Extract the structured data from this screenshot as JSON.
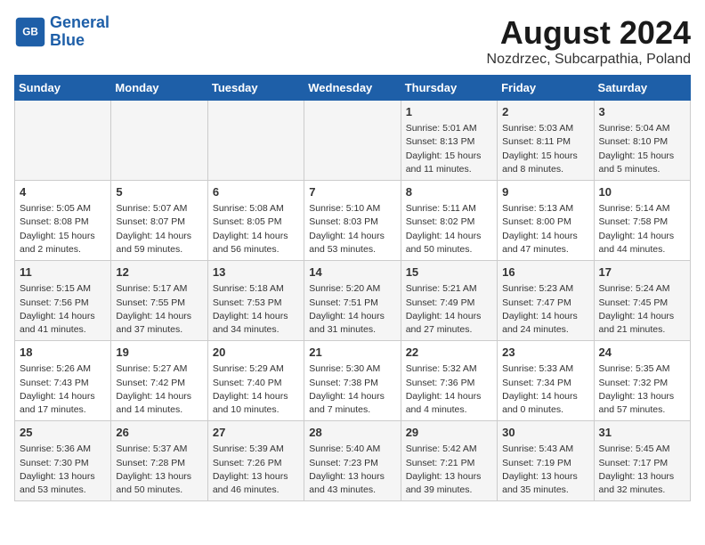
{
  "logo": {
    "line1": "General",
    "line2": "Blue"
  },
  "title": "August 2024",
  "subtitle": "Nozdrzec, Subcarpathia, Poland",
  "days_of_week": [
    "Sunday",
    "Monday",
    "Tuesday",
    "Wednesday",
    "Thursday",
    "Friday",
    "Saturday"
  ],
  "weeks": [
    [
      {
        "day": "",
        "info": ""
      },
      {
        "day": "",
        "info": ""
      },
      {
        "day": "",
        "info": ""
      },
      {
        "day": "",
        "info": ""
      },
      {
        "day": "1",
        "info": "Sunrise: 5:01 AM\nSunset: 8:13 PM\nDaylight: 15 hours\nand 11 minutes."
      },
      {
        "day": "2",
        "info": "Sunrise: 5:03 AM\nSunset: 8:11 PM\nDaylight: 15 hours\nand 8 minutes."
      },
      {
        "day": "3",
        "info": "Sunrise: 5:04 AM\nSunset: 8:10 PM\nDaylight: 15 hours\nand 5 minutes."
      }
    ],
    [
      {
        "day": "4",
        "info": "Sunrise: 5:05 AM\nSunset: 8:08 PM\nDaylight: 15 hours\nand 2 minutes."
      },
      {
        "day": "5",
        "info": "Sunrise: 5:07 AM\nSunset: 8:07 PM\nDaylight: 14 hours\nand 59 minutes."
      },
      {
        "day": "6",
        "info": "Sunrise: 5:08 AM\nSunset: 8:05 PM\nDaylight: 14 hours\nand 56 minutes."
      },
      {
        "day": "7",
        "info": "Sunrise: 5:10 AM\nSunset: 8:03 PM\nDaylight: 14 hours\nand 53 minutes."
      },
      {
        "day": "8",
        "info": "Sunrise: 5:11 AM\nSunset: 8:02 PM\nDaylight: 14 hours\nand 50 minutes."
      },
      {
        "day": "9",
        "info": "Sunrise: 5:13 AM\nSunset: 8:00 PM\nDaylight: 14 hours\nand 47 minutes."
      },
      {
        "day": "10",
        "info": "Sunrise: 5:14 AM\nSunset: 7:58 PM\nDaylight: 14 hours\nand 44 minutes."
      }
    ],
    [
      {
        "day": "11",
        "info": "Sunrise: 5:15 AM\nSunset: 7:56 PM\nDaylight: 14 hours\nand 41 minutes."
      },
      {
        "day": "12",
        "info": "Sunrise: 5:17 AM\nSunset: 7:55 PM\nDaylight: 14 hours\nand 37 minutes."
      },
      {
        "day": "13",
        "info": "Sunrise: 5:18 AM\nSunset: 7:53 PM\nDaylight: 14 hours\nand 34 minutes."
      },
      {
        "day": "14",
        "info": "Sunrise: 5:20 AM\nSunset: 7:51 PM\nDaylight: 14 hours\nand 31 minutes."
      },
      {
        "day": "15",
        "info": "Sunrise: 5:21 AM\nSunset: 7:49 PM\nDaylight: 14 hours\nand 27 minutes."
      },
      {
        "day": "16",
        "info": "Sunrise: 5:23 AM\nSunset: 7:47 PM\nDaylight: 14 hours\nand 24 minutes."
      },
      {
        "day": "17",
        "info": "Sunrise: 5:24 AM\nSunset: 7:45 PM\nDaylight: 14 hours\nand 21 minutes."
      }
    ],
    [
      {
        "day": "18",
        "info": "Sunrise: 5:26 AM\nSunset: 7:43 PM\nDaylight: 14 hours\nand 17 minutes."
      },
      {
        "day": "19",
        "info": "Sunrise: 5:27 AM\nSunset: 7:42 PM\nDaylight: 14 hours\nand 14 minutes."
      },
      {
        "day": "20",
        "info": "Sunrise: 5:29 AM\nSunset: 7:40 PM\nDaylight: 14 hours\nand 10 minutes."
      },
      {
        "day": "21",
        "info": "Sunrise: 5:30 AM\nSunset: 7:38 PM\nDaylight: 14 hours\nand 7 minutes."
      },
      {
        "day": "22",
        "info": "Sunrise: 5:32 AM\nSunset: 7:36 PM\nDaylight: 14 hours\nand 4 minutes."
      },
      {
        "day": "23",
        "info": "Sunrise: 5:33 AM\nSunset: 7:34 PM\nDaylight: 14 hours\nand 0 minutes."
      },
      {
        "day": "24",
        "info": "Sunrise: 5:35 AM\nSunset: 7:32 PM\nDaylight: 13 hours\nand 57 minutes."
      }
    ],
    [
      {
        "day": "25",
        "info": "Sunrise: 5:36 AM\nSunset: 7:30 PM\nDaylight: 13 hours\nand 53 minutes."
      },
      {
        "day": "26",
        "info": "Sunrise: 5:37 AM\nSunset: 7:28 PM\nDaylight: 13 hours\nand 50 minutes."
      },
      {
        "day": "27",
        "info": "Sunrise: 5:39 AM\nSunset: 7:26 PM\nDaylight: 13 hours\nand 46 minutes."
      },
      {
        "day": "28",
        "info": "Sunrise: 5:40 AM\nSunset: 7:23 PM\nDaylight: 13 hours\nand 43 minutes."
      },
      {
        "day": "29",
        "info": "Sunrise: 5:42 AM\nSunset: 7:21 PM\nDaylight: 13 hours\nand 39 minutes."
      },
      {
        "day": "30",
        "info": "Sunrise: 5:43 AM\nSunset: 7:19 PM\nDaylight: 13 hours\nand 35 minutes."
      },
      {
        "day": "31",
        "info": "Sunrise: 5:45 AM\nSunset: 7:17 PM\nDaylight: 13 hours\nand 32 minutes."
      }
    ]
  ]
}
